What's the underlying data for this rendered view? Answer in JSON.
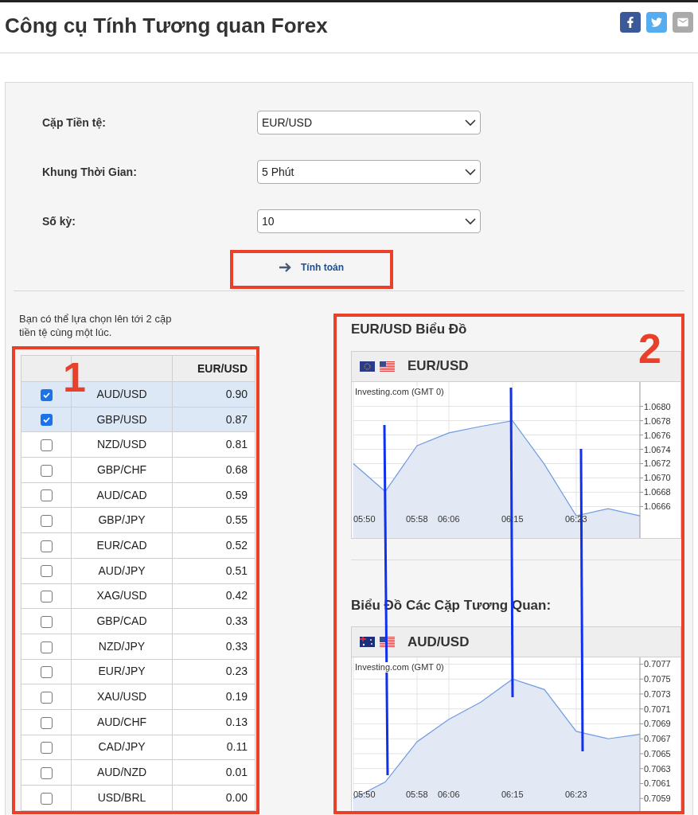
{
  "title": "Công cụ Tính Tương quan Forex",
  "share_buttons": [
    {
      "kind": "facebook"
    },
    {
      "kind": "twitter"
    },
    {
      "kind": "email"
    }
  ],
  "form": {
    "fields": [
      {
        "label": "Cặp Tiền tệ:",
        "value": "EUR/USD"
      },
      {
        "label": "Khung Thời Gian:",
        "value": "5 Phút"
      },
      {
        "label": "Số kỳ:",
        "value": "10"
      }
    ],
    "submit": "Tính toán"
  },
  "hint": "Bạn có thể lựa chọn lên tới 2 cặp tiền tệ cùng một lúc.",
  "table": {
    "columns": [
      "EUR/USD"
    ],
    "rows": [
      {
        "pair": "AUD/USD",
        "value": "0.90",
        "checked": true
      },
      {
        "pair": "GBP/USD",
        "value": "0.87",
        "checked": true
      },
      {
        "pair": "NZD/USD",
        "value": "0.81",
        "checked": false
      },
      {
        "pair": "GBP/CHF",
        "value": "0.68",
        "checked": false
      },
      {
        "pair": "AUD/CAD",
        "value": "0.59",
        "checked": false
      },
      {
        "pair": "GBP/JPY",
        "value": "0.55",
        "checked": false
      },
      {
        "pair": "EUR/CAD",
        "value": "0.52",
        "checked": false
      },
      {
        "pair": "AUD/JPY",
        "value": "0.51",
        "checked": false
      },
      {
        "pair": "XAG/USD",
        "value": "0.42",
        "checked": false
      },
      {
        "pair": "GBP/CAD",
        "value": "0.33",
        "checked": false
      },
      {
        "pair": "NZD/JPY",
        "value": "0.33",
        "checked": false
      },
      {
        "pair": "EUR/JPY",
        "value": "0.23",
        "checked": false
      },
      {
        "pair": "XAU/USD",
        "value": "0.19",
        "checked": false
      },
      {
        "pair": "AUD/CHF",
        "value": "0.13",
        "checked": false
      },
      {
        "pair": "CAD/JPY",
        "value": "0.11",
        "checked": false
      },
      {
        "pair": "AUD/NZD",
        "value": "0.01",
        "checked": false
      },
      {
        "pair": "USD/BRL",
        "value": "0.00",
        "checked": false
      }
    ]
  },
  "charts": [
    {
      "title": "EUR/USD Biểu Đồ",
      "pair": "EUR/USD",
      "source": "Investing.com (GMT 0)",
      "chart_data": {
        "type": "area",
        "grid": true,
        "categories": [
          "05:50",
          null,
          "05:58",
          "06:06",
          null,
          "06:15",
          null,
          "06:23",
          null,
          null
        ],
        "series": [
          {
            "color": "#6f9be0",
            "values": [
              1.0672,
              1.06681,
              1.06745,
              1.06763,
              1.06772,
              1.0678,
              1.06719,
              1.06647,
              1.06657,
              1.06647
            ]
          }
        ],
        "ylim": [
          1.06616,
          1.06834
        ],
        "yticks": [
          {
            "value": 1.0666,
            "label": "1.0666"
          },
          {
            "value": 1.0668,
            "label": "1.0668"
          },
          {
            "value": 1.067,
            "label": "1.0670"
          },
          {
            "value": 1.0672,
            "label": "1.0672"
          },
          {
            "value": 1.0674,
            "label": "1.0674"
          },
          {
            "value": 1.0676,
            "label": "1.0676"
          },
          {
            "value": 1.0678,
            "label": "1.0678"
          },
          {
            "value": 1.068,
            "label": "1.0680"
          }
        ]
      }
    },
    {
      "title": "Biểu Đồ Các Cặp Tương Quan:",
      "pair": "AUD/USD",
      "source": "Investing.com (GMT 0)",
      "chart_data": {
        "type": "area",
        "grid": true,
        "categories": [
          "05:50",
          null,
          "05:58",
          "06:06",
          null,
          "06:15",
          null,
          "06:23",
          null,
          null
        ],
        "series": [
          {
            "color": "#6f9be0",
            "values": [
              0.7059,
              0.70612,
              0.70666,
              0.70696,
              0.70719,
              0.7075,
              0.70736,
              0.7068,
              0.7067,
              0.70676
            ]
          }
        ],
        "ylim": [
          0.7057,
          0.70779
        ],
        "yticks": [
          {
            "value": 0.7059,
            "label": "0.7059"
          },
          {
            "value": 0.7061,
            "label": "0.7061"
          },
          {
            "value": 0.7063,
            "label": "0.7063"
          },
          {
            "value": 0.7065,
            "label": "0.7065"
          },
          {
            "value": 0.7067,
            "label": "0.7067"
          },
          {
            "value": 0.7069,
            "label": "0.7069"
          },
          {
            "value": 0.7071,
            "label": "0.7071"
          },
          {
            "value": 0.7073,
            "label": "0.7073"
          },
          {
            "value": 0.7075,
            "label": "0.7075"
          },
          {
            "value": 0.7077,
            "label": "0.7077"
          }
        ]
      }
    }
  ],
  "annotation_numbers": [
    "1",
    "2"
  ]
}
